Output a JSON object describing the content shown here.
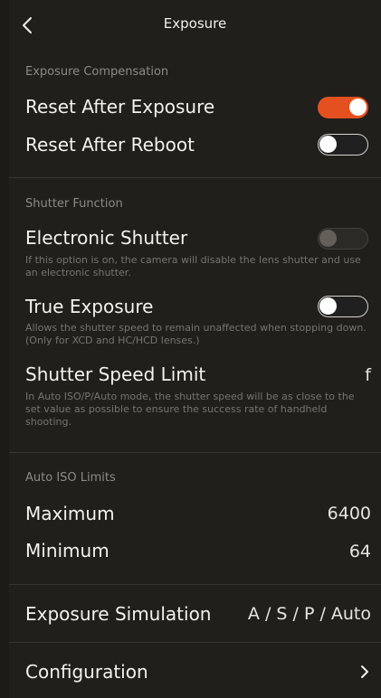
{
  "header": {
    "title": "Exposure"
  },
  "sections": {
    "exposure_compensation": {
      "label": "Exposure Compensation",
      "reset_after_exposure": {
        "label": "Reset After Exposure",
        "on": true
      },
      "reset_after_reboot": {
        "label": "Reset After Reboot",
        "on": false
      }
    },
    "shutter_function": {
      "label": "Shutter Function",
      "electronic_shutter": {
        "label": "Electronic Shutter",
        "desc": "If this option is on, the camera will disable the lens shutter and use an electronic shutter.",
        "on": false,
        "disabled": true
      },
      "true_exposure": {
        "label": "True Exposure",
        "desc": "Allows the shutter speed to remain unaffected when stopping down. (Only for XCD and HC/HCD lenses.)",
        "on": false
      },
      "shutter_speed_limit": {
        "label": "Shutter Speed Limit",
        "value": "f",
        "desc": "In Auto ISO/P/Auto mode, the shutter speed will be as close to the set value as possible to ensure the success rate of handheld shooting."
      }
    },
    "auto_iso": {
      "label": "Auto ISO Limits",
      "maximum": {
        "label": "Maximum",
        "value": "6400"
      },
      "minimum": {
        "label": "Minimum",
        "value": "64"
      }
    },
    "exposure_simulation": {
      "label": "Exposure Simulation",
      "value": "A / S / P / Auto"
    },
    "configuration": {
      "label": "Configuration"
    }
  },
  "colors": {
    "accent": "#e4501f",
    "background": "#211f1b"
  }
}
